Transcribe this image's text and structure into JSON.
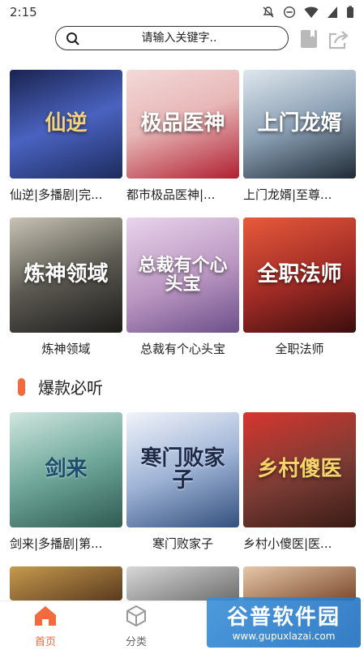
{
  "status_bar": {
    "time": "2:15"
  },
  "header": {
    "search_placeholder": "请输入关键字.."
  },
  "row1": [
    {
      "title": "仙逆|多播剧|完...",
      "cover_text": "仙逆",
      "cover_bg": "#2a3f8a"
    },
    {
      "title": "都市极品医神|...",
      "cover_text": "极品医神",
      "cover_bg": "#c4283a"
    },
    {
      "title": "上门龙婿|至尊...",
      "cover_text": "上门龙婿",
      "cover_bg": "#4c5d6e"
    }
  ],
  "row2": [
    {
      "title": "炼神领域",
      "cover_text": "炼神领域",
      "cover_bg": "#3b3a36"
    },
    {
      "title": "总裁有个心头宝",
      "cover_text": "总裁有个心头宝",
      "cover_bg": "#b995c0"
    },
    {
      "title": "全职法师",
      "cover_text": "全职法师",
      "cover_bg": "#9e2a25"
    }
  ],
  "section": {
    "title": "爆款必听",
    "accent": "#f26a3d"
  },
  "row3": [
    {
      "title": "剑来|多播剧|第...",
      "cover_text": "剑来",
      "cover_bg": "#4f8f84"
    },
    {
      "title": "寒门败家子",
      "cover_text": "寒门败家子",
      "cover_bg": "#5d7cb0"
    },
    {
      "title": "乡村小傻医|医...",
      "cover_text": "乡村傻医",
      "cover_bg": "#7a3c34"
    }
  ],
  "tabbar": {
    "home_label": "首页",
    "category_label": "分类",
    "active_color": "#f26a3d"
  },
  "watermark": {
    "line1": "谷普软件园",
    "line2": "www.gupuxlazai.com"
  }
}
